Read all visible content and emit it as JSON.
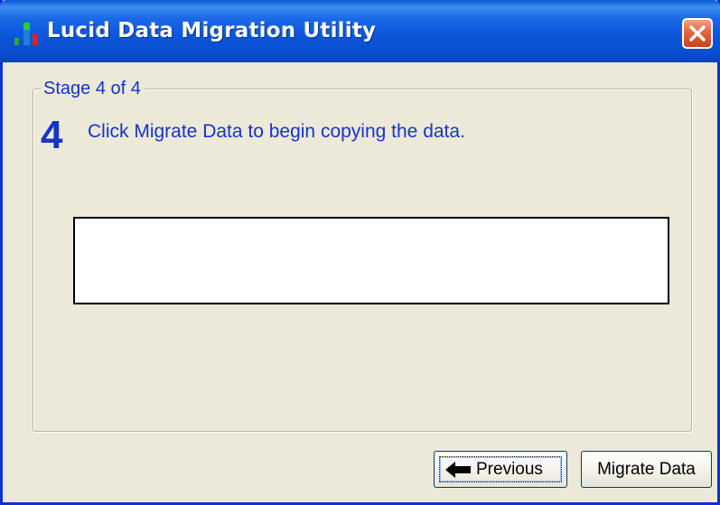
{
  "window": {
    "title": "Lucid Data Migration Utility",
    "app_icon": "app-bars-icon",
    "close_icon": "close-icon"
  },
  "stage": {
    "legend": "Stage 4 of 4",
    "number": "4",
    "instruction": "Click Migrate Data to begin copying the data."
  },
  "progress": {
    "value": 0
  },
  "buttons": {
    "previous_label": "Previous",
    "previous_icon": "arrow-left-icon",
    "migrate_label": "Migrate Data"
  },
  "colors": {
    "titlebar": "#0a55d8",
    "text_accent": "#1535c8",
    "close_button": "#e2643e",
    "window_background": "#ece9d8"
  }
}
